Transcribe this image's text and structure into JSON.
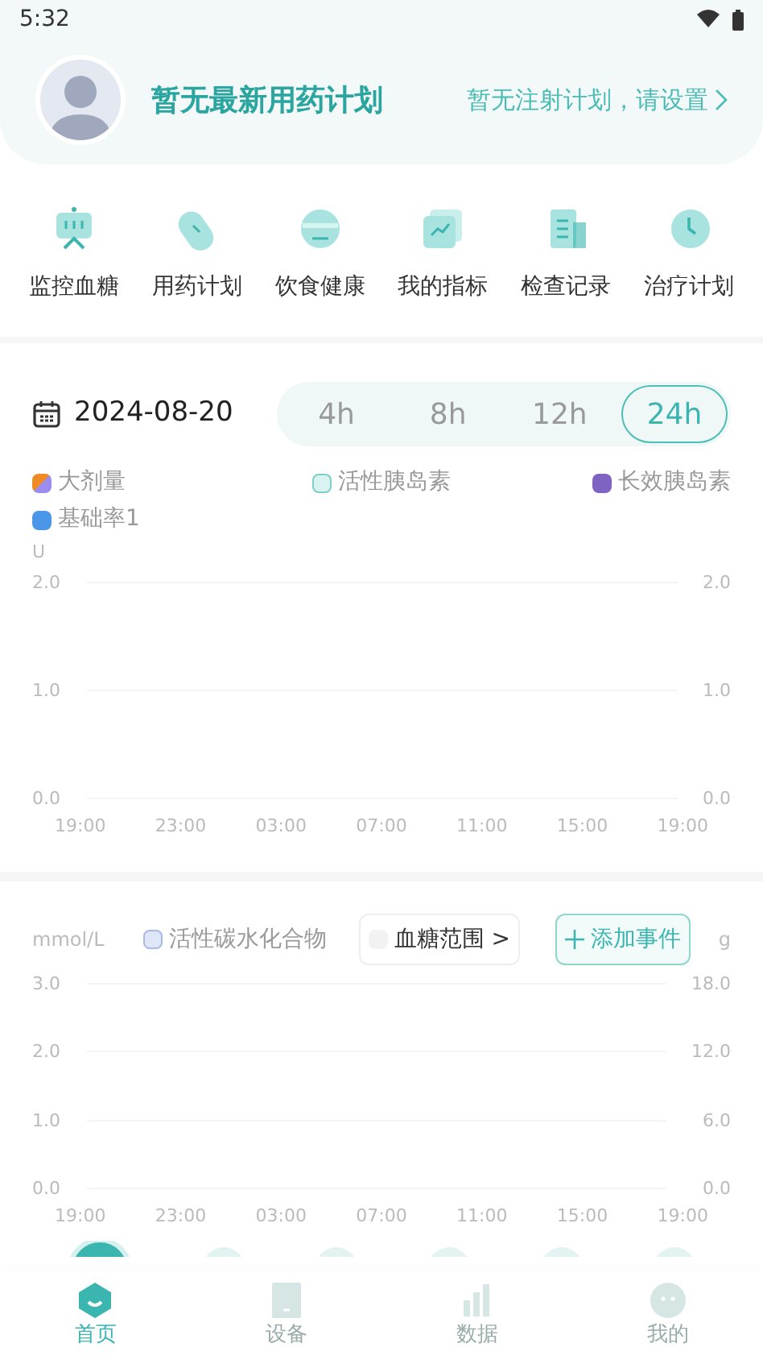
{
  "status_bar": {
    "time": "5:32"
  },
  "header": {
    "title": "暂无最新用药计划",
    "link": "暂无注射计划，请设置"
  },
  "shortcuts": [
    {
      "label": "监控血糖",
      "kind": "monitor"
    },
    {
      "label": "用药计划",
      "kind": "pill"
    },
    {
      "label": "饮食健康",
      "kind": "bowl"
    },
    {
      "label": "我的指标",
      "kind": "chart"
    },
    {
      "label": "检查记录",
      "kind": "doc"
    },
    {
      "label": "治疗计划",
      "kind": "clock"
    }
  ],
  "date": "2024-08-20",
  "ranges": [
    {
      "label": "4h",
      "selected": false
    },
    {
      "label": "8h",
      "selected": false
    },
    {
      "label": "12h",
      "selected": false
    },
    {
      "label": "24h",
      "selected": true
    }
  ],
  "insulin_legend": [
    {
      "label": "大剂量",
      "color": "#f08a24",
      "kind": "split"
    },
    {
      "label": "活性胰岛素",
      "color": "#d9f3f1",
      "kind": "outline"
    },
    {
      "label": "长效胰岛素",
      "color": "#7e63c2",
      "kind": "solid"
    },
    {
      "label": "基础率1",
      "color": "#4a96e8",
      "kind": "solid"
    }
  ],
  "insulin_chart": {
    "unit": "U",
    "left_ticks": [
      "2.0",
      "1.0",
      "0.0"
    ],
    "right_ticks": [
      "2.0",
      "1.0",
      "0.0"
    ],
    "x_ticks": [
      "19:00",
      "23:00",
      "03:00",
      "07:00",
      "11:00",
      "15:00",
      "19:00"
    ]
  },
  "glucose_chart": {
    "left_unit": "mmol/L",
    "right_unit": "g",
    "carb_legend": "活性碳水化合物",
    "range_toggle": {
      "label": "血糖范围 >",
      "checked": false
    },
    "add_button": "添加事件",
    "left_ticks": [
      "3.0",
      "2.0",
      "1.0",
      "0.0"
    ],
    "right_ticks": [
      "18.0",
      "12.0",
      "6.0",
      "0.0"
    ],
    "x_ticks": [
      "19:00",
      "23:00",
      "03:00",
      "07:00",
      "11:00",
      "15:00",
      "19:00"
    ]
  },
  "nav": [
    {
      "label": "首页",
      "selected": true
    },
    {
      "label": "设备",
      "selected": false
    },
    {
      "label": "数据",
      "selected": false
    },
    {
      "label": "我的",
      "selected": false
    }
  ]
}
